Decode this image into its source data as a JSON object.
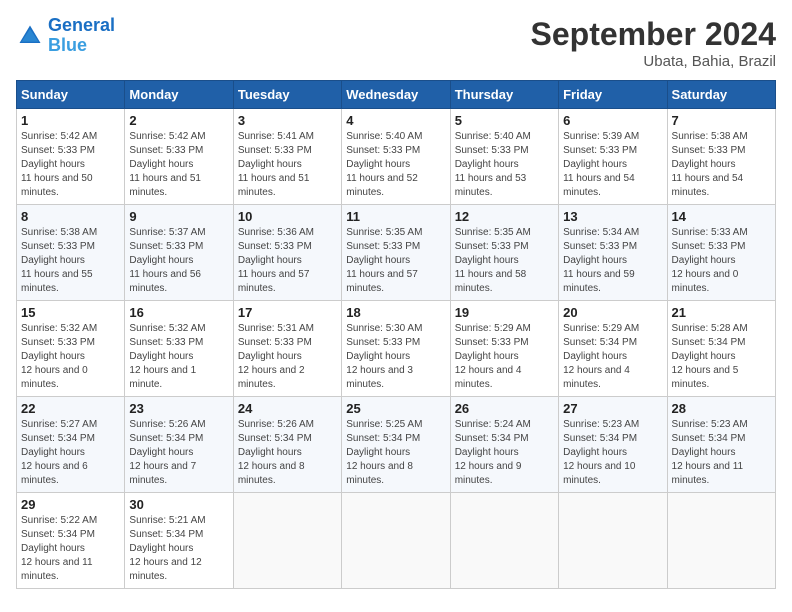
{
  "header": {
    "logo_line1": "General",
    "logo_line2": "Blue",
    "month_title": "September 2024",
    "subtitle": "Ubata, Bahia, Brazil"
  },
  "weekdays": [
    "Sunday",
    "Monday",
    "Tuesday",
    "Wednesday",
    "Thursday",
    "Friday",
    "Saturday"
  ],
  "days": [
    {
      "day": null,
      "sunrise": null,
      "sunset": null,
      "daylight": null
    },
    {
      "day": "1",
      "sunrise": "5:42 AM",
      "sunset": "5:33 PM",
      "daylight": "11 hours and 50 minutes."
    },
    {
      "day": "2",
      "sunrise": "5:42 AM",
      "sunset": "5:33 PM",
      "daylight": "11 hours and 51 minutes."
    },
    {
      "day": "3",
      "sunrise": "5:41 AM",
      "sunset": "5:33 PM",
      "daylight": "11 hours and 51 minutes."
    },
    {
      "day": "4",
      "sunrise": "5:40 AM",
      "sunset": "5:33 PM",
      "daylight": "11 hours and 52 minutes."
    },
    {
      "day": "5",
      "sunrise": "5:40 AM",
      "sunset": "5:33 PM",
      "daylight": "11 hours and 53 minutes."
    },
    {
      "day": "6",
      "sunrise": "5:39 AM",
      "sunset": "5:33 PM",
      "daylight": "11 hours and 54 minutes."
    },
    {
      "day": "7",
      "sunrise": "5:38 AM",
      "sunset": "5:33 PM",
      "daylight": "11 hours and 54 minutes."
    },
    {
      "day": "8",
      "sunrise": "5:38 AM",
      "sunset": "5:33 PM",
      "daylight": "11 hours and 55 minutes."
    },
    {
      "day": "9",
      "sunrise": "5:37 AM",
      "sunset": "5:33 PM",
      "daylight": "11 hours and 56 minutes."
    },
    {
      "day": "10",
      "sunrise": "5:36 AM",
      "sunset": "5:33 PM",
      "daylight": "11 hours and 57 minutes."
    },
    {
      "day": "11",
      "sunrise": "5:35 AM",
      "sunset": "5:33 PM",
      "daylight": "11 hours and 57 minutes."
    },
    {
      "day": "12",
      "sunrise": "5:35 AM",
      "sunset": "5:33 PM",
      "daylight": "11 hours and 58 minutes."
    },
    {
      "day": "13",
      "sunrise": "5:34 AM",
      "sunset": "5:33 PM",
      "daylight": "11 hours and 59 minutes."
    },
    {
      "day": "14",
      "sunrise": "5:33 AM",
      "sunset": "5:33 PM",
      "daylight": "12 hours and 0 minutes."
    },
    {
      "day": "15",
      "sunrise": "5:32 AM",
      "sunset": "5:33 PM",
      "daylight": "12 hours and 0 minutes."
    },
    {
      "day": "16",
      "sunrise": "5:32 AM",
      "sunset": "5:33 PM",
      "daylight": "12 hours and 1 minute."
    },
    {
      "day": "17",
      "sunrise": "5:31 AM",
      "sunset": "5:33 PM",
      "daylight": "12 hours and 2 minutes."
    },
    {
      "day": "18",
      "sunrise": "5:30 AM",
      "sunset": "5:33 PM",
      "daylight": "12 hours and 3 minutes."
    },
    {
      "day": "19",
      "sunrise": "5:29 AM",
      "sunset": "5:33 PM",
      "daylight": "12 hours and 4 minutes."
    },
    {
      "day": "20",
      "sunrise": "5:29 AM",
      "sunset": "5:34 PM",
      "daylight": "12 hours and 4 minutes."
    },
    {
      "day": "21",
      "sunrise": "5:28 AM",
      "sunset": "5:34 PM",
      "daylight": "12 hours and 5 minutes."
    },
    {
      "day": "22",
      "sunrise": "5:27 AM",
      "sunset": "5:34 PM",
      "daylight": "12 hours and 6 minutes."
    },
    {
      "day": "23",
      "sunrise": "5:26 AM",
      "sunset": "5:34 PM",
      "daylight": "12 hours and 7 minutes."
    },
    {
      "day": "24",
      "sunrise": "5:26 AM",
      "sunset": "5:34 PM",
      "daylight": "12 hours and 8 minutes."
    },
    {
      "day": "25",
      "sunrise": "5:25 AM",
      "sunset": "5:34 PM",
      "daylight": "12 hours and 8 minutes."
    },
    {
      "day": "26",
      "sunrise": "5:24 AM",
      "sunset": "5:34 PM",
      "daylight": "12 hours and 9 minutes."
    },
    {
      "day": "27",
      "sunrise": "5:23 AM",
      "sunset": "5:34 PM",
      "daylight": "12 hours and 10 minutes."
    },
    {
      "day": "28",
      "sunrise": "5:23 AM",
      "sunset": "5:34 PM",
      "daylight": "12 hours and 11 minutes."
    },
    {
      "day": "29",
      "sunrise": "5:22 AM",
      "sunset": "5:34 PM",
      "daylight": "12 hours and 11 minutes."
    },
    {
      "day": "30",
      "sunrise": "5:21 AM",
      "sunset": "5:34 PM",
      "daylight": "12 hours and 12 minutes."
    },
    {
      "day": null,
      "sunrise": null,
      "sunset": null,
      "daylight": null
    },
    {
      "day": null,
      "sunrise": null,
      "sunset": null,
      "daylight": null
    },
    {
      "day": null,
      "sunrise": null,
      "sunset": null,
      "daylight": null
    },
    {
      "day": null,
      "sunrise": null,
      "sunset": null,
      "daylight": null
    },
    {
      "day": null,
      "sunrise": null,
      "sunset": null,
      "daylight": null
    }
  ],
  "labels": {
    "sunrise": "Sunrise:",
    "sunset": "Sunset:",
    "daylight": "Daylight hours"
  }
}
